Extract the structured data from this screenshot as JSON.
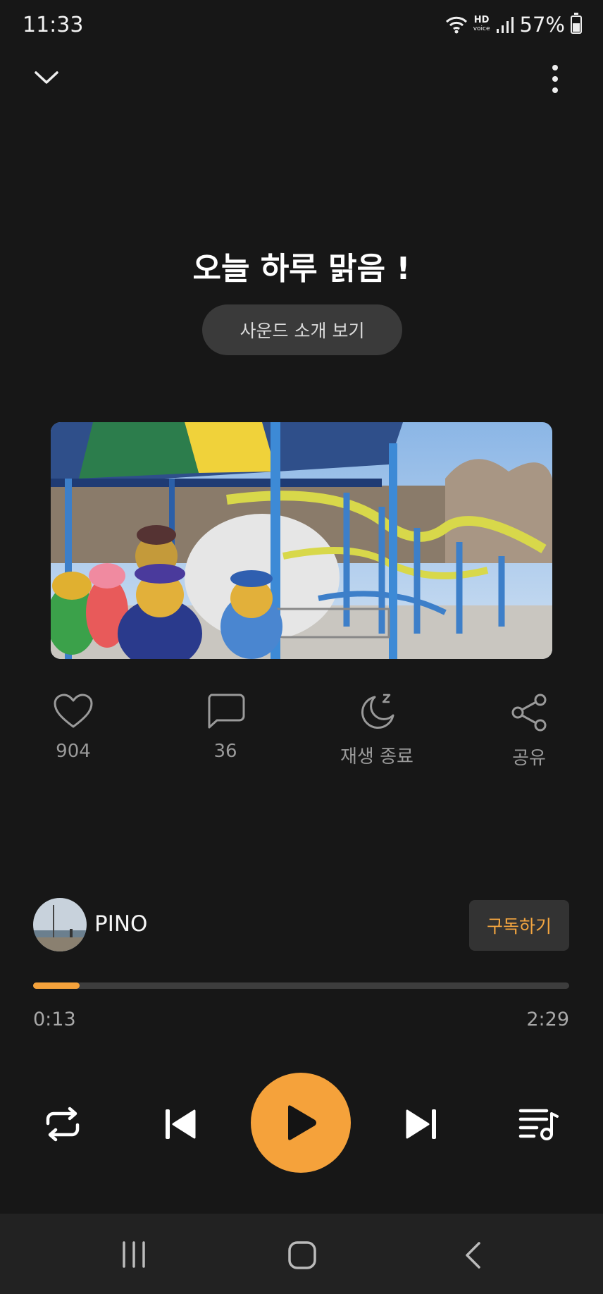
{
  "status": {
    "time": "11:33",
    "hd": "HD",
    "voice": "voice",
    "battery": "57%"
  },
  "track": {
    "title": "오늘 하루 맑음 !",
    "intro_button": "사운드 소개 보기"
  },
  "actions": {
    "likes": "904",
    "comments": "36",
    "sleep_timer": "재생 종료",
    "share": "공유"
  },
  "artist": {
    "name": "PINO",
    "subscribe": "구독하기"
  },
  "player": {
    "elapsed": "0:13",
    "duration": "2:29",
    "progress": 0.087
  }
}
